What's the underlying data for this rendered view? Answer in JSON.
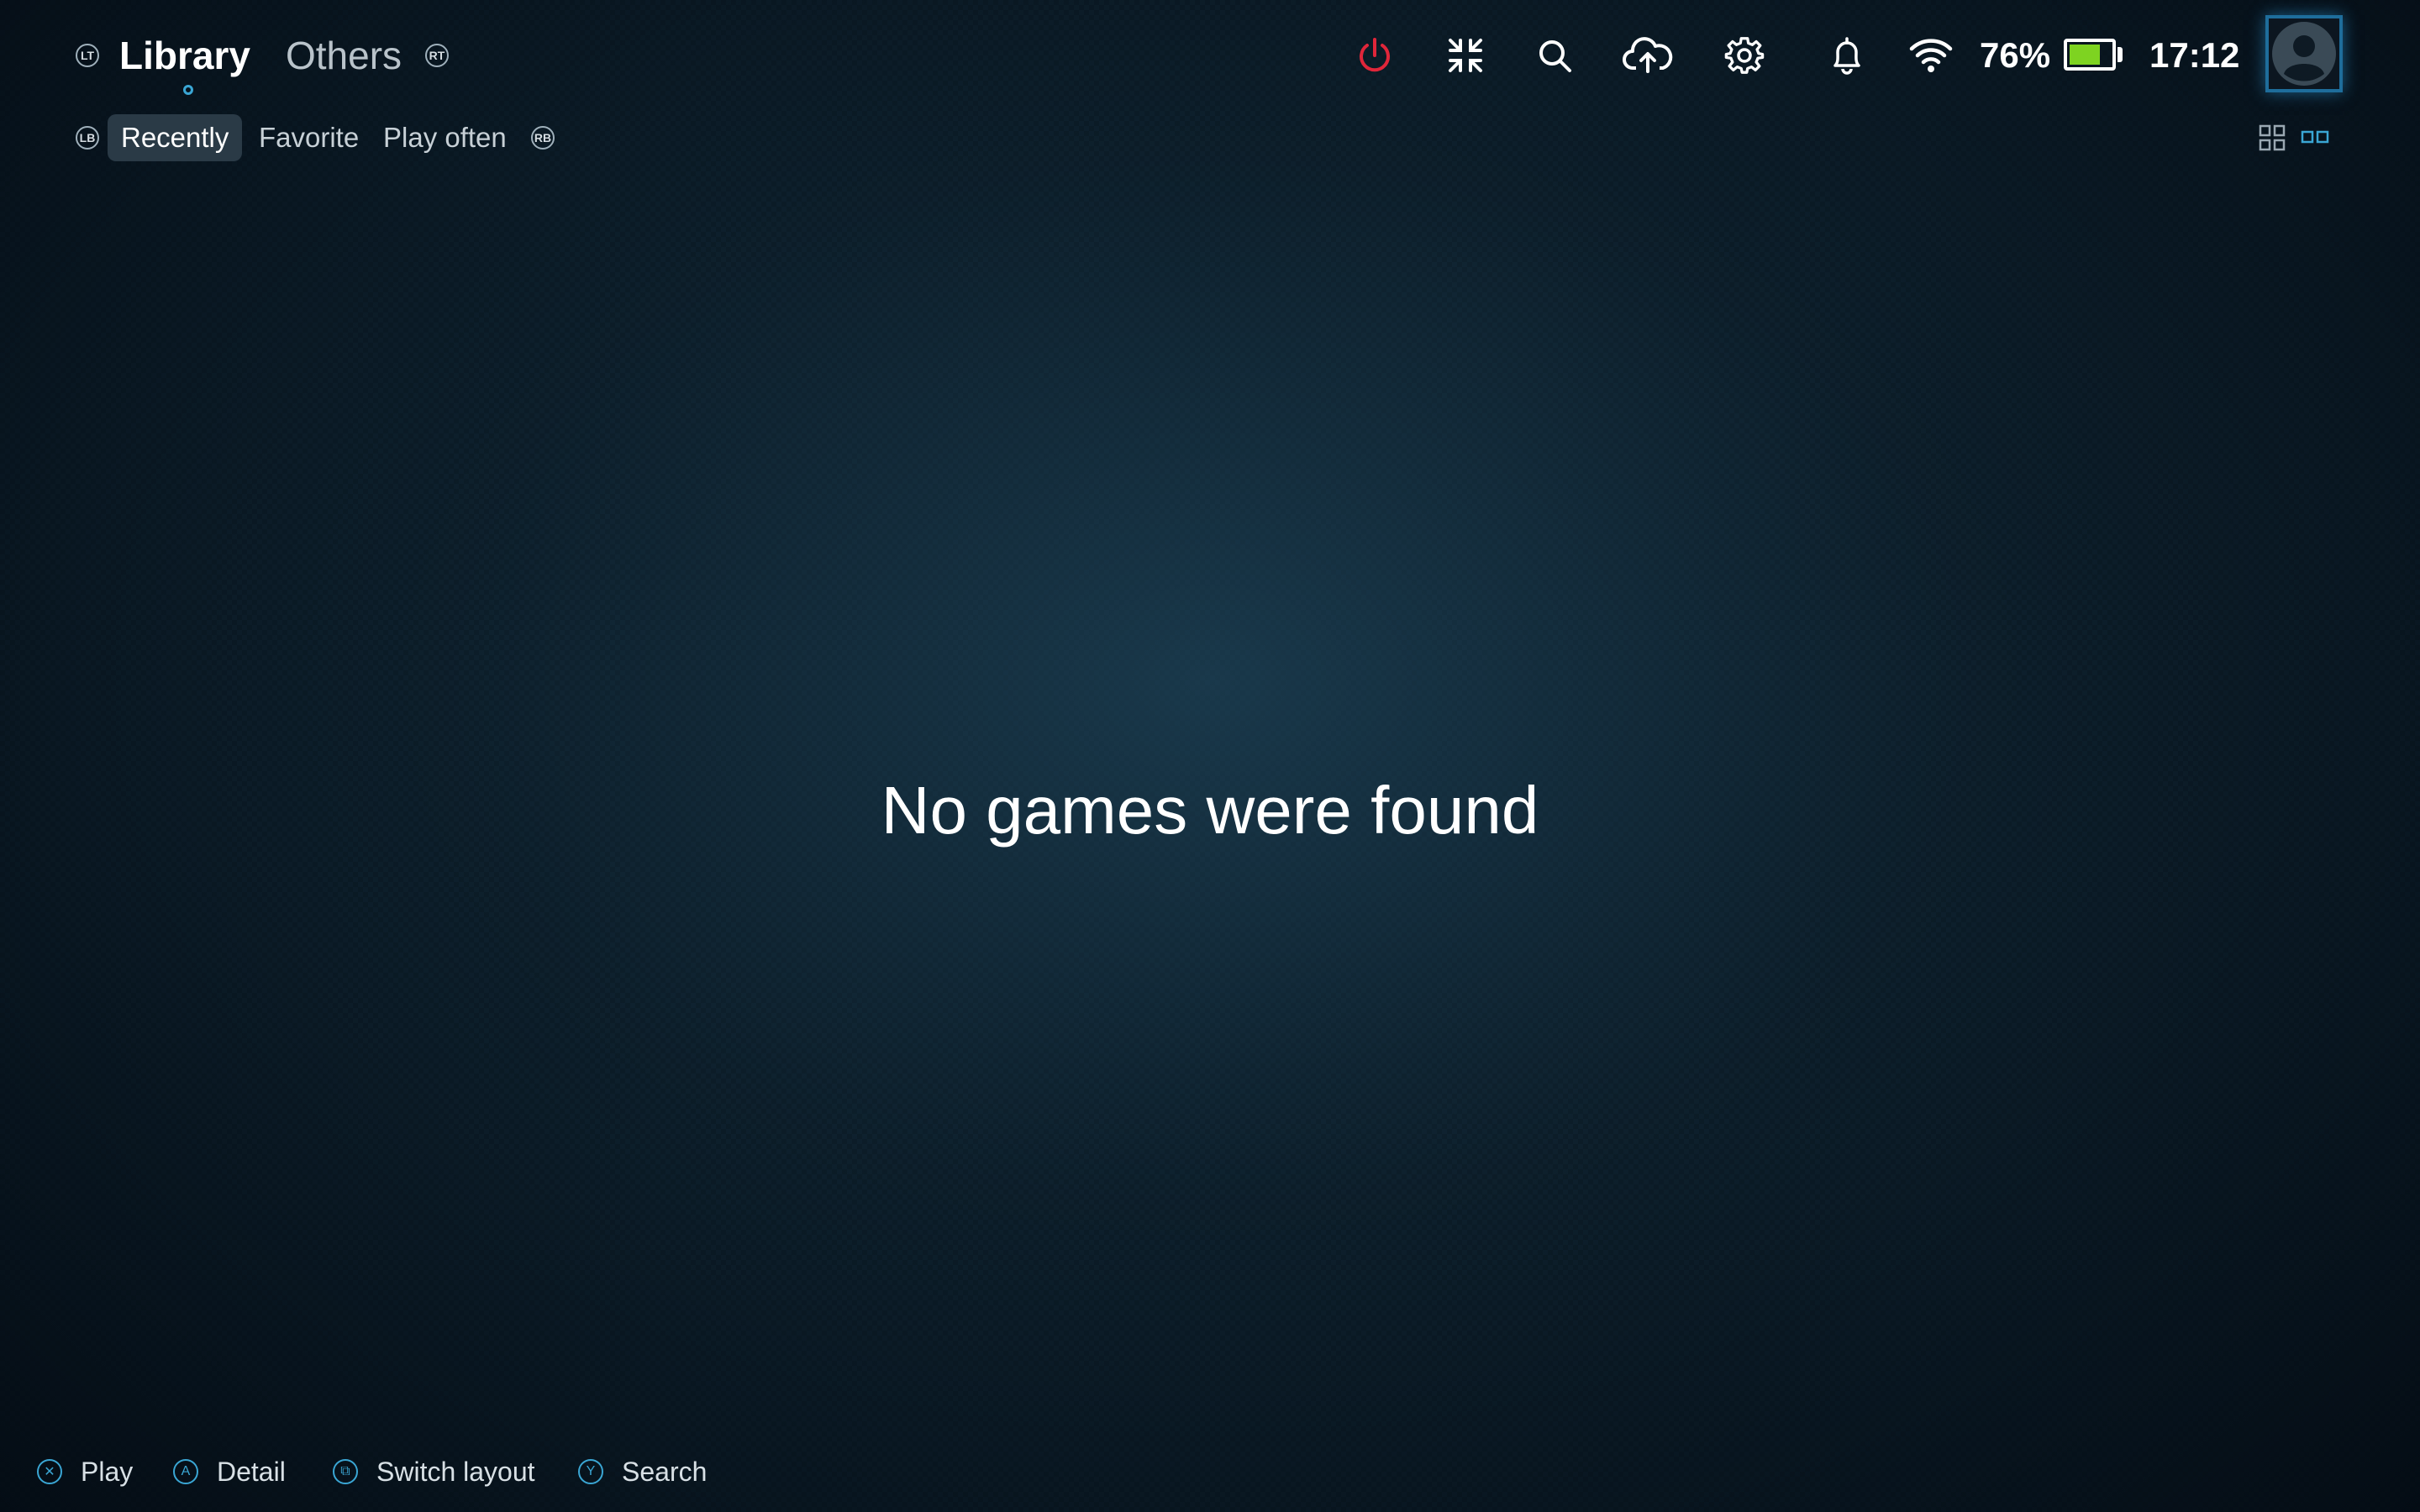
{
  "top_nav": {
    "left_bumper": "LT",
    "right_bumper": "RT",
    "tabs": [
      {
        "label": "Library",
        "active": true
      },
      {
        "label": "Others",
        "active": false
      }
    ]
  },
  "status": {
    "icons": [
      "power-icon",
      "fullscreen-exit-icon",
      "search-icon",
      "cloud-upload-icon",
      "gear-icon",
      "bell-icon",
      "wifi-icon"
    ],
    "power_color": "#e0263a",
    "battery_percent": "76%",
    "battery_level": 0.76,
    "battery_color": "#7ed321",
    "time": "17:12"
  },
  "sub_nav": {
    "left_bumper": "LB",
    "right_bumper": "RB",
    "tabs": [
      {
        "label": "Recently",
        "active": true
      },
      {
        "label": "Favorite",
        "active": false
      },
      {
        "label": "Play often",
        "active": false
      }
    ],
    "layout_icons": [
      "grid-layout-icon",
      "list-layout-icon"
    ]
  },
  "main": {
    "empty_message": "No games were found"
  },
  "hints": [
    {
      "glyph": "✕",
      "label": "Play",
      "icon": "cross-button-icon"
    },
    {
      "glyph": "A",
      "label": "Detail",
      "icon": "a-button-icon"
    },
    {
      "glyph": "⧉",
      "label": "Switch layout",
      "icon": "view-button-icon"
    },
    {
      "glyph": "Y",
      "label": "Search",
      "icon": "y-button-icon"
    }
  ],
  "accent_color": "#3aa6d4"
}
